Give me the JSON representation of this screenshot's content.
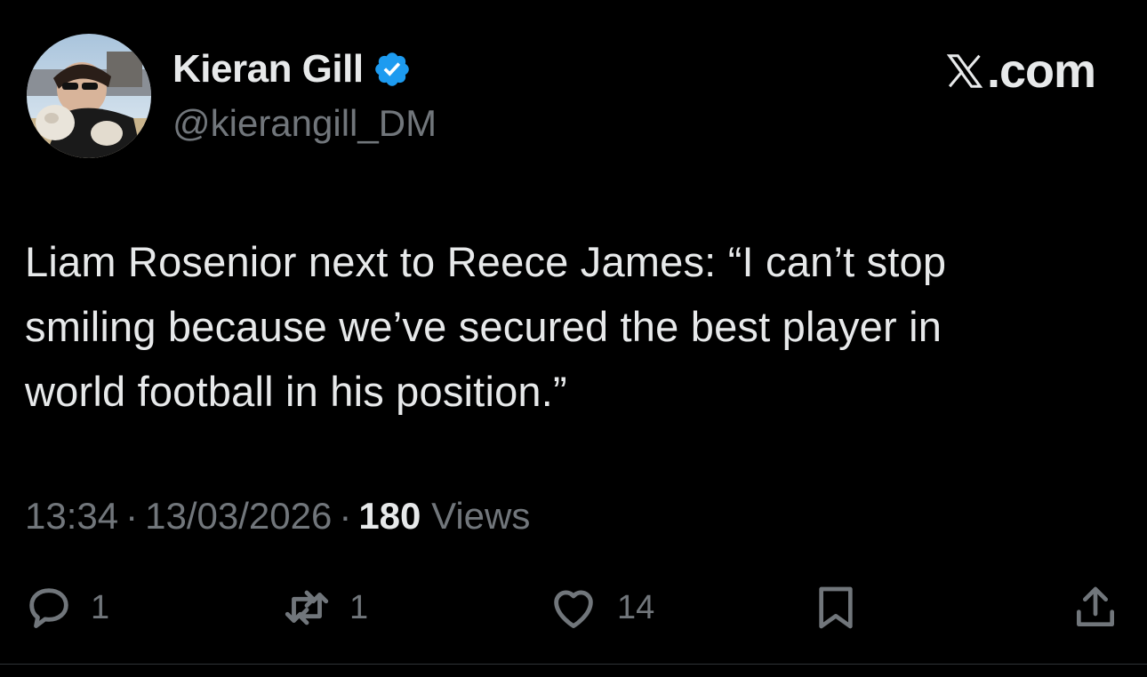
{
  "author": {
    "name": "Kieran Gill",
    "handle": "@kierangill_DM",
    "verified": true,
    "verified_color": "#1d9bf0",
    "avatar_icon": "profile-photo"
  },
  "brand": {
    "label": ".com",
    "icon": "x-logo-icon"
  },
  "tweet": {
    "text": "Liam Rosenior next to Reece James: “I can’t stop\nsmiling because we’ve secured the best player in\nworld football in his position.”",
    "time": "13:34",
    "date": "13/03/2026",
    "separator": "·",
    "views_count": "180",
    "views_label": "Views"
  },
  "actions": {
    "reply": {
      "icon": "reply-icon",
      "count": "1"
    },
    "repost": {
      "icon": "repost-icon",
      "count": "1"
    },
    "like": {
      "icon": "heart-icon",
      "count": "14"
    },
    "bookmark": {
      "icon": "bookmark-icon"
    },
    "share": {
      "icon": "share-icon"
    }
  },
  "colors": {
    "background": "#000000",
    "text_primary": "#e7e9ea",
    "text_secondary": "#71767b"
  }
}
